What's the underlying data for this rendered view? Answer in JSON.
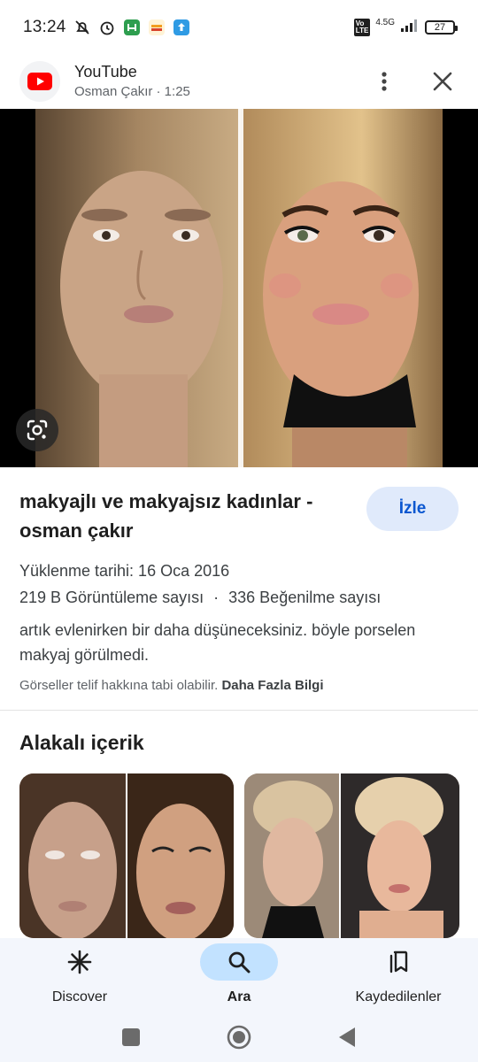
{
  "status_bar": {
    "time": "13:24",
    "network": "4.5G",
    "volte": "Vo LTE",
    "battery": "27"
  },
  "source": {
    "site_name": "YouTube",
    "subtitle": "Osman Çakır · 1:25",
    "icon": "youtube-logo-icon"
  },
  "result": {
    "title": "makyajlı ve makyajsız kadınlar - osman çakır",
    "watch_label": "İzle",
    "upload_date": "Yüklenme tarihi: 16 Oca 2016",
    "views": "219 B Görüntüleme sayısı",
    "separator": "·",
    "likes": "336 Beğenilme sayısı",
    "description": "artık evlenirken bir daha düşüneceksiniz. böyle porselen makyaj görülmedi.",
    "copyright_text": "Görseller telif hakkına tabi olabilir.",
    "more_info_label": "Daha Fazla Bilgi"
  },
  "related": {
    "title": "Alakalı içerik"
  },
  "bottom_nav": {
    "items": [
      {
        "label": "Discover",
        "icon": "asterisk-icon",
        "active": false
      },
      {
        "label": "Ara",
        "icon": "search-icon",
        "active": true
      },
      {
        "label": "Kaydedilenler",
        "icon": "bookmarks-icon",
        "active": false
      }
    ]
  },
  "colors": {
    "accent": "#0b57d0",
    "watch_bg": "#e0eafb",
    "nav_active": "#c2e2ff",
    "nav_bg": "#f3f6fc",
    "youtube_red": "#ff0000"
  }
}
